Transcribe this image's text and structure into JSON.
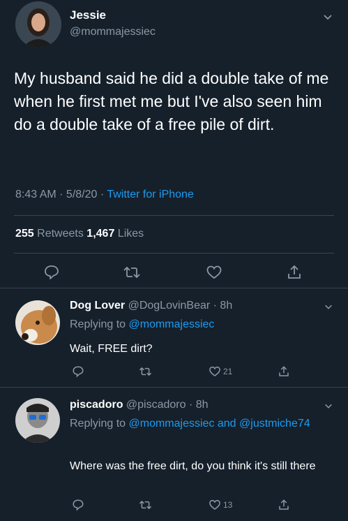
{
  "tweet": {
    "author_name": "Jessie",
    "author_handle": "@mommajessiec",
    "text": "My husband said he did a double take of me when he first met me but I've also seen him do a double take of a free pile of dirt.",
    "time": "8:43 AM · 5/8/20 · ",
    "source": "Twitter for iPhone",
    "retweets_count": "255",
    "retweets_label": " Retweets ",
    "likes_count": "1,467",
    "likes_label": " Likes"
  },
  "replies": [
    {
      "author_name": "Dog Lover",
      "meta": " @DogLovinBear · 8h",
      "replying_prefix": "Replying to ",
      "replying_to": "@mommajessiec",
      "text": "Wait, FREE dirt?",
      "like_count": "21"
    },
    {
      "author_name": "piscadoro",
      "meta": " @piscadoro · 8h",
      "replying_prefix": "Replying to ",
      "replying_to": "@mommajessiec and @justmiche74",
      "text": "Where was the free dirt, do you think it's still there",
      "like_count": "13"
    }
  ],
  "icons": [
    "chevron-down-icon",
    "reply-icon",
    "retweet-icon",
    "like-icon",
    "share-icon"
  ],
  "colors": {
    "background": "#15202b",
    "accent": "#1d9bf0",
    "muted": "#8b98a5",
    "divider": "#38444d"
  }
}
